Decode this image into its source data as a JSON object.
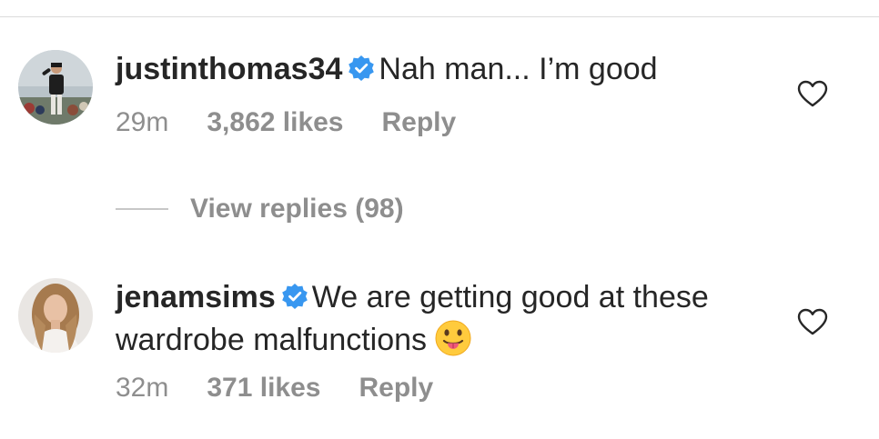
{
  "comments": [
    {
      "username": "justinthomas34",
      "verified": true,
      "text": "Nah man... I’m good",
      "time": "29m",
      "likes": "3,862 likes",
      "reply_label": "Reply",
      "avatar_icon": "golfer-photo"
    },
    {
      "username": "jenamsims",
      "verified": true,
      "text": "We are getting good at these wardrobe malfunctions",
      "time": "32m",
      "likes": "371 likes",
      "reply_label": "Reply",
      "avatar_icon": "profile-photo",
      "emoji": "tongue-out-emoji"
    }
  ],
  "view_replies": {
    "label": "View replies (98)"
  },
  "colors": {
    "text": "#262626",
    "muted": "#8e8e8e",
    "verified_blue": "#3897f0",
    "divider": "#dbdbdb"
  },
  "icons": {
    "verified": "verified-badge-icon",
    "like": "heart-outline-icon"
  }
}
